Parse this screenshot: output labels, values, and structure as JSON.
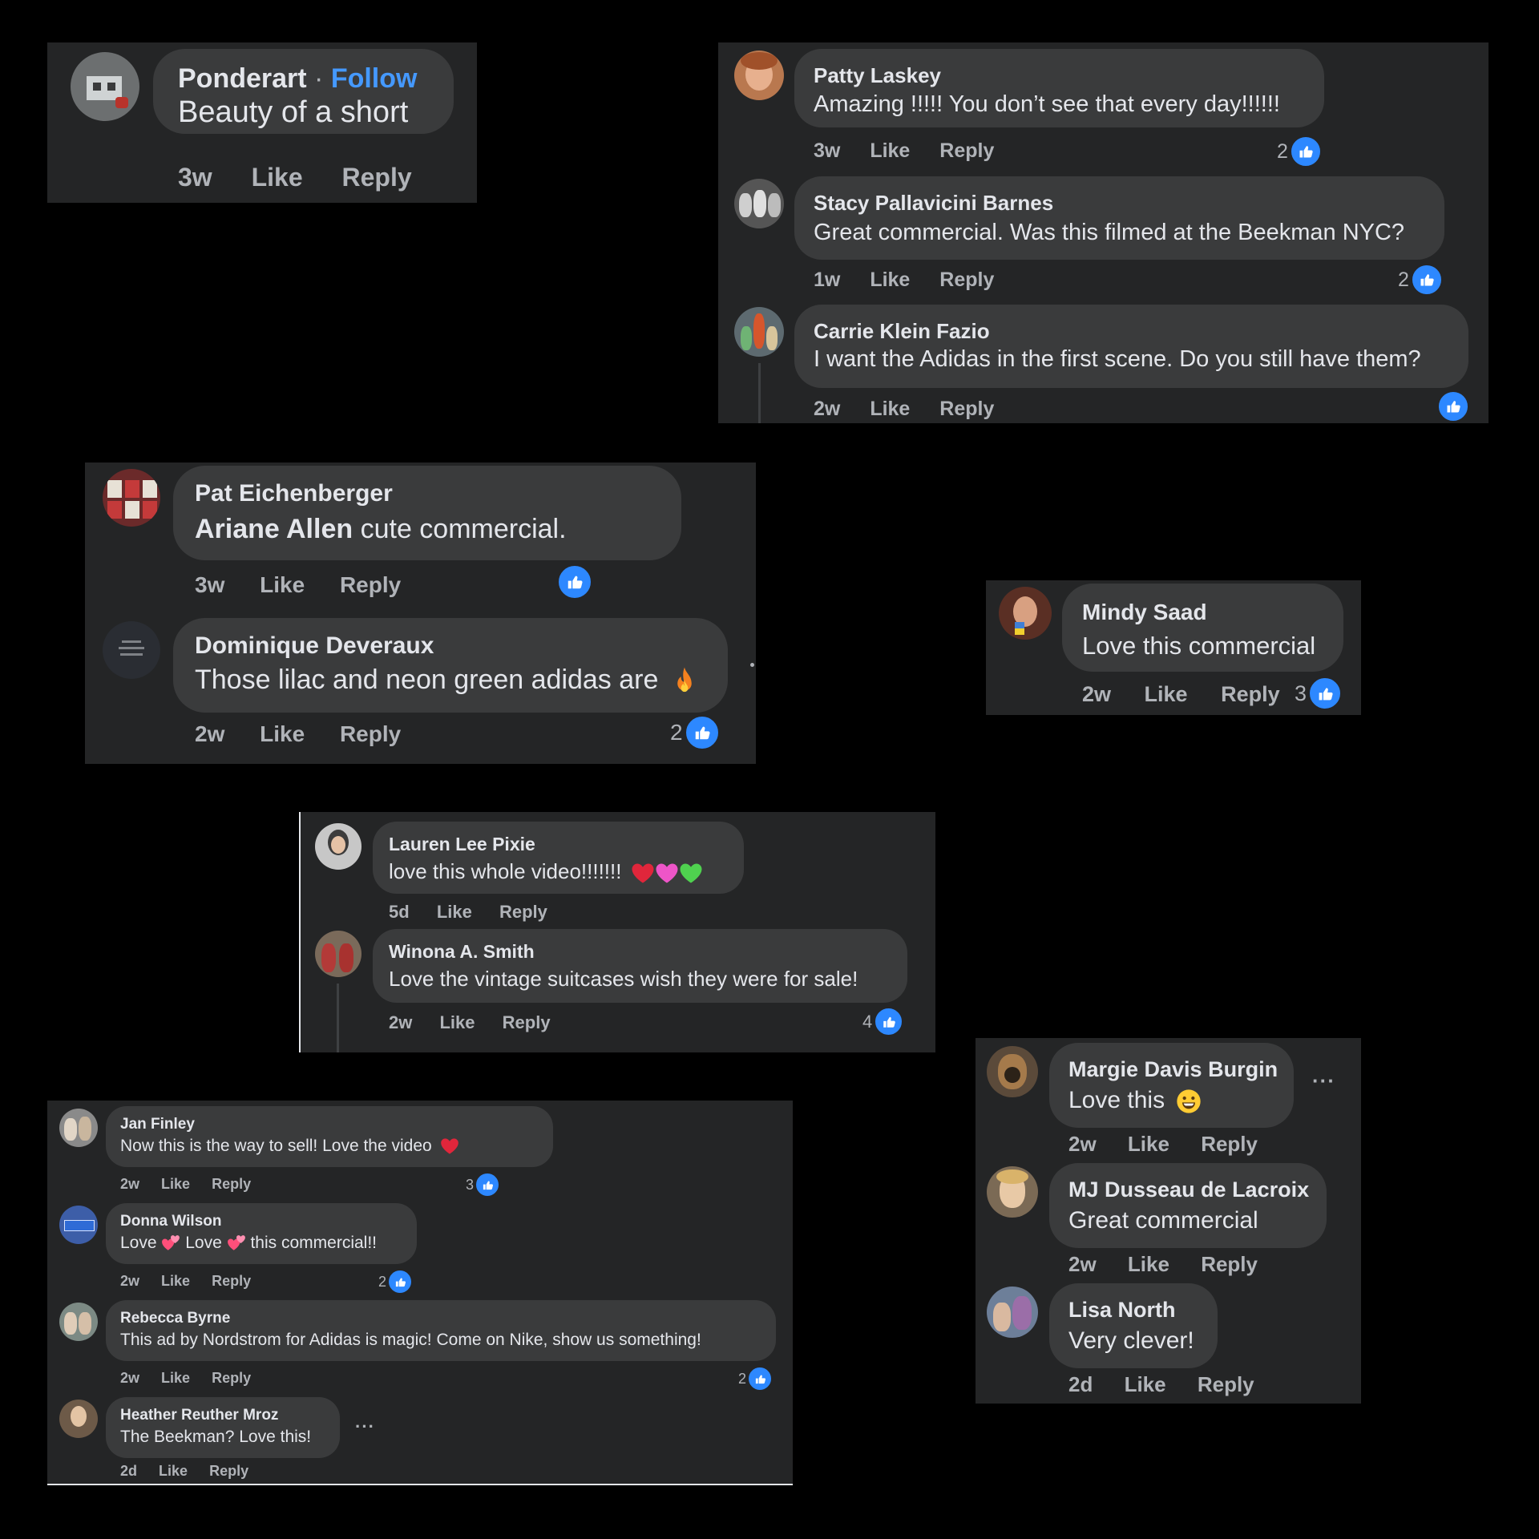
{
  "panels": {
    "p1": {
      "comments": [
        {
          "name": "Ponderart",
          "follow": "Follow",
          "sep": "·",
          "text": "Beauty of a short",
          "time": "3w",
          "like": "Like",
          "reply": "Reply"
        }
      ]
    },
    "p2": {
      "comments": [
        {
          "name": "Patty Laskey",
          "text": "Amazing !!!!! You don’t see that every day!!!!!!",
          "time": "3w",
          "like": "Like",
          "reply": "Reply",
          "reactions": "2"
        },
        {
          "name": "Stacy Pallavicini Barnes",
          "text": "Great commercial. Was this filmed at the Beekman NYC?",
          "time": "1w",
          "like": "Like",
          "reply": "Reply",
          "reactions": "2"
        },
        {
          "name": "Carrie Klein Fazio",
          "text": "I want the Adidas in the first scene. Do you still have them?",
          "time": "2w",
          "like": "Like",
          "reply": "Reply",
          "reactions": ""
        }
      ]
    },
    "p3": {
      "comments": [
        {
          "name": "Pat Eichenberger",
          "mention": "Ariane Allen",
          "text": " cute commercial.",
          "time": "3w",
          "like": "Like",
          "reply": "Reply",
          "reactions": ""
        },
        {
          "name": "Dominique Deveraux",
          "text": "Those lilac and neon green adidas are",
          "time": "2w",
          "like": "Like",
          "reply": "Reply",
          "reactions": "2"
        }
      ]
    },
    "p4": {
      "comments": [
        {
          "name": "Mindy Saad",
          "text": "Love this commercial",
          "time": "2w",
          "like": "Like",
          "reply": "Reply",
          "reactions": "3"
        }
      ]
    },
    "p5": {
      "comments": [
        {
          "name": "Lauren Lee Pixie",
          "text": "love this whole video!!!!!!!",
          "time": "5d",
          "like": "Like",
          "reply": "Reply"
        },
        {
          "name": "Winona A. Smith",
          "text": "Love the vintage suitcases wish they were for sale!",
          "time": "2w",
          "like": "Like",
          "reply": "Reply",
          "reactions": "4"
        }
      ]
    },
    "p6": {
      "comments": [
        {
          "name": "Jan Finley",
          "text": "Now this is the way to sell! Love the video",
          "time": "2w",
          "like": "Like",
          "reply": "Reply",
          "reactions": "3"
        },
        {
          "name": "Donna Wilson",
          "text1": "Love",
          "text2": "Love",
          "text3": "this commercial!!",
          "time": "2w",
          "like": "Like",
          "reply": "Reply",
          "reactions": "2"
        },
        {
          "name": "Rebecca Byrne",
          "text": "This ad by Nordstrom for Adidas is magic! Come on Nike, show us something!",
          "time": "2w",
          "like": "Like",
          "reply": "Reply",
          "reactions": "2"
        },
        {
          "name": "Heather Reuther Mroz",
          "text": "The Beekman? Love this!",
          "time": "2d",
          "like": "Like",
          "reply": "Reply",
          "more": "···"
        }
      ]
    },
    "p7": {
      "comments": [
        {
          "name": "Margie Davis Burgin",
          "text": "Love this",
          "time": "2w",
          "like": "Like",
          "reply": "Reply",
          "more": "···"
        },
        {
          "name": "MJ Dusseau de Lacroix",
          "text": "Great commercial",
          "time": "2w",
          "like": "Like",
          "reply": "Reply"
        },
        {
          "name": "Lisa North",
          "text": "Very clever!",
          "time": "2d",
          "like": "Like",
          "reply": "Reply"
        }
      ]
    }
  },
  "colors": {
    "panel": "#242526",
    "bubble": "#3a3b3c",
    "accent": "#2d88ff",
    "follow": "#4599ff",
    "muted": "#b0b3b8"
  }
}
